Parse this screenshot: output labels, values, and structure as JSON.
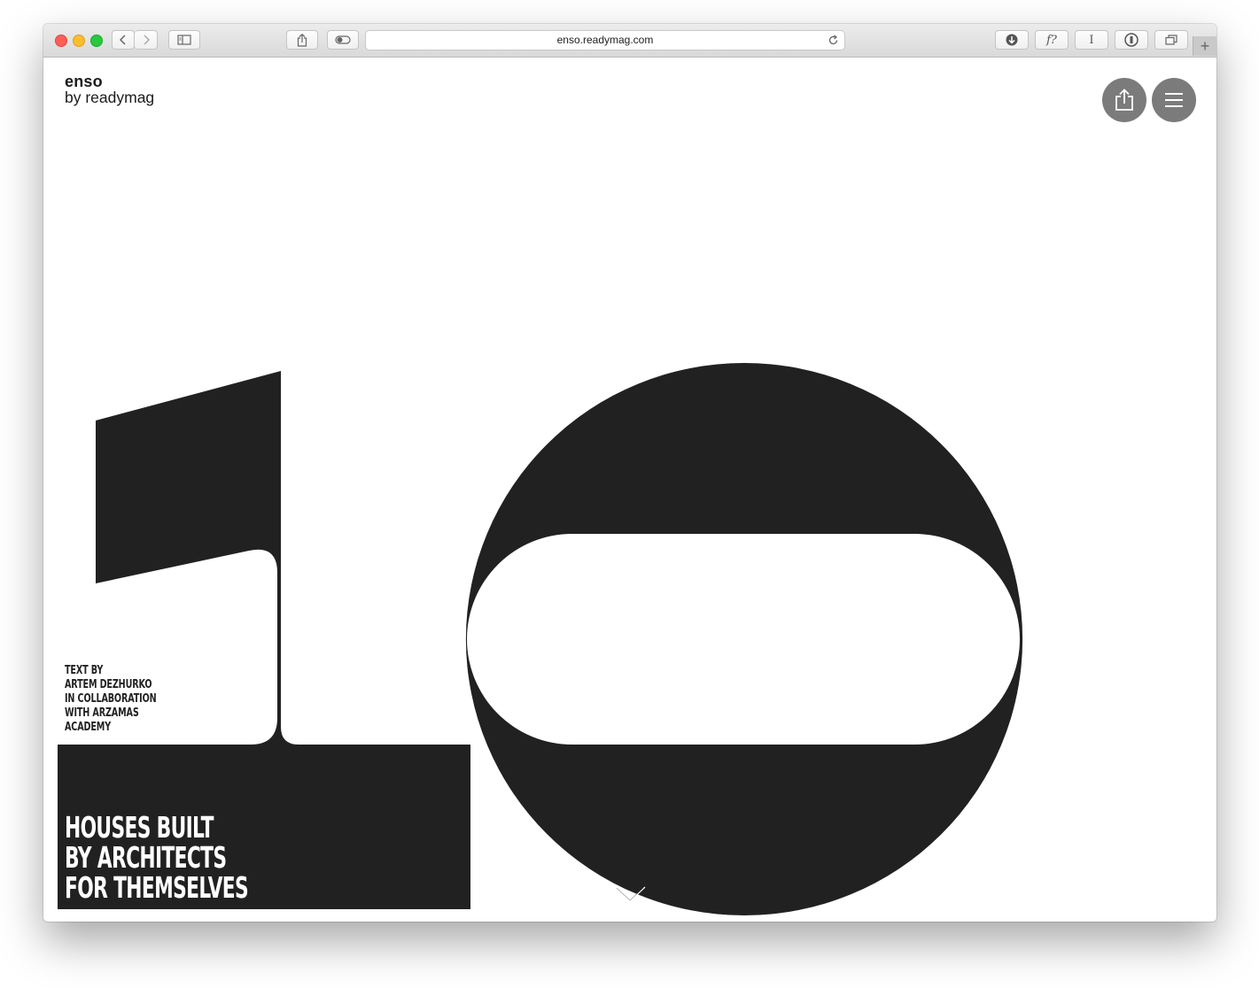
{
  "browser": {
    "url": "enso.readymag.com",
    "buttons": [
      "back",
      "forward",
      "sidebar",
      "share",
      "toggle",
      "downloads",
      "font-finder",
      "cursor-text",
      "password-manager",
      "tabs-overview",
      "new-tab"
    ],
    "font_finder_label": "f?",
    "cursor_label": "I",
    "new_tab_label": "+"
  },
  "site": {
    "logo_line1": "enso",
    "logo_line2": "by readymag",
    "share_button_icon": "share-icon",
    "menu_button_icon": "hamburger-menu-icon"
  },
  "hero": {
    "credits": [
      "TEXT BY",
      "ARTEM DEZHURKO",
      "IN COLLABORATION",
      "WITH ARZAMAS",
      "ACADEMY"
    ],
    "title_lines": [
      "HOUSES BUILT",
      "BY ARCHITECTS",
      "FOR THEMSELVES"
    ],
    "scroll_icon": "chevron-down-icon"
  },
  "colors": {
    "ink": "#222122",
    "button_gray": "#7b7b7b",
    "background": "#ffffff"
  }
}
